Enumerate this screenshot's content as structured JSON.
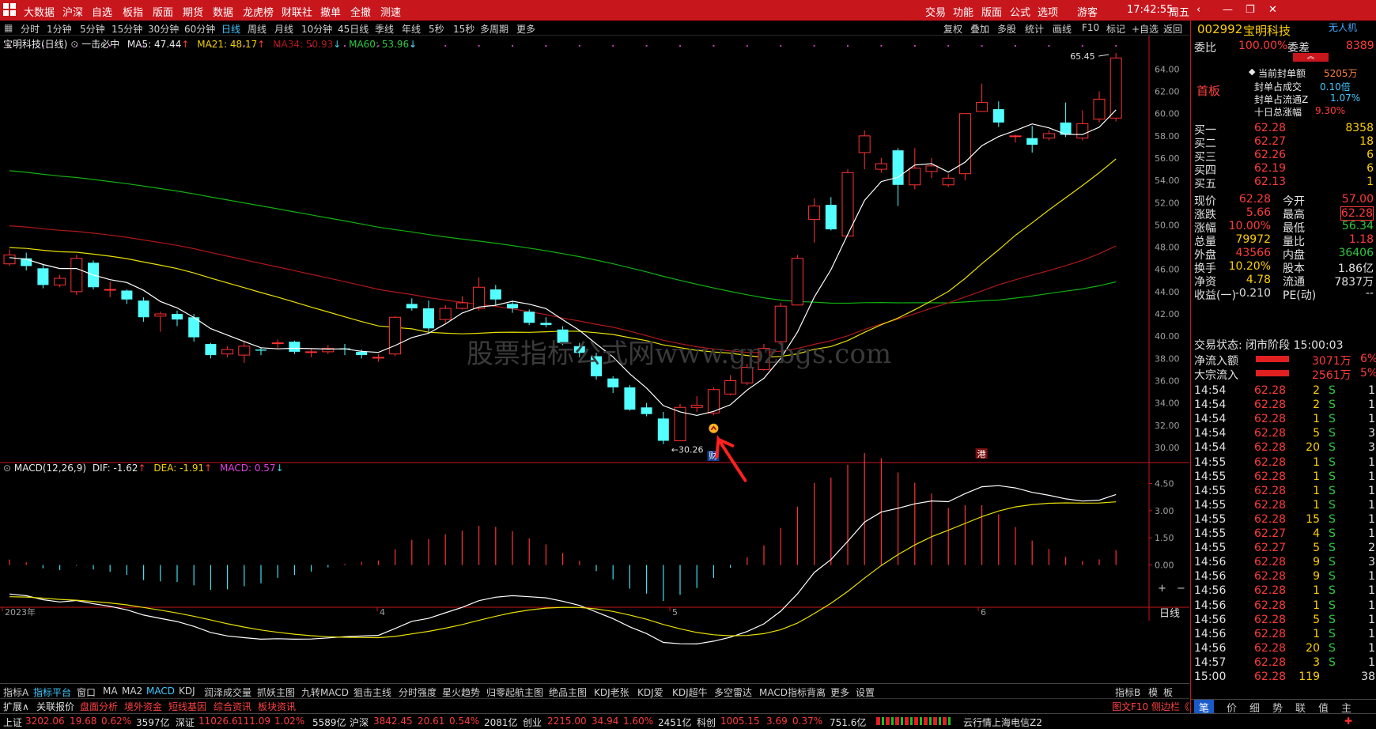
{
  "menubar": {
    "items": [
      "大数据",
      "沪深",
      "自选",
      "板指",
      "版面",
      "期货",
      "数据",
      "龙虎榜",
      "财联社",
      "撤单",
      "全撤",
      "测速"
    ],
    "right_items": [
      "交易",
      "功能",
      "版面",
      "公式",
      "选项",
      "游客"
    ],
    "clock": "17:42:55",
    "weekday": "周五"
  },
  "periods": [
    "分时",
    "1分钟",
    "5分钟",
    "15分钟",
    "30分钟",
    "60分钟",
    "日线",
    "周线",
    "月线",
    "10分钟",
    "45日线",
    "季线",
    "年线",
    "5秒",
    "15秒",
    "多周期",
    "更多"
  ],
  "period_active": "日线",
  "toolbar_right": [
    "复权",
    "叠加",
    "多股",
    "统计",
    "画线",
    "F10",
    "标记",
    "+自选",
    "返回"
  ],
  "chart_header": {
    "stock_title": "宝明科技(日线)",
    "formula": "一击必中",
    "ma5": "MA5: 47.44",
    "ma21": "MA21: 48.17",
    "ma34": "MA34: 50.93",
    "ma60": "MA60: 53.96"
  },
  "price_axis": [
    "64.00",
    "62.00",
    "60.00",
    "58.00",
    "56.00",
    "54.00",
    "52.00",
    "50.00",
    "48.00",
    "46.00",
    "44.00",
    "42.00",
    "40.00",
    "38.00",
    "36.00",
    "34.00",
    "32.00",
    "30.00"
  ],
  "annotations": {
    "high": "65.45",
    "low": "30.26",
    "cai": "财",
    "gang": "港"
  },
  "watermark": "股票指标公式网www.gpzbgs.com",
  "macd_header": {
    "name": "MACD(12,26,9)",
    "dif": "DIF: -1.62",
    "dea": "DEA: -1.91",
    "macd": "MACD: 0.57"
  },
  "macd_axis": [
    "4.50",
    "3.00",
    "1.50",
    "0.00"
  ],
  "date_axis": [
    "2023年",
    "4",
    "5",
    "6"
  ],
  "date_period_label": "日线",
  "indicator_tabs": [
    "指标A",
    "指标平台",
    "窗口",
    "MA",
    "MA2",
    "MACD",
    "KDJ",
    "润泽成交量",
    "抓妖主图",
    "九转MACD",
    "狙击主线",
    "分时强度",
    "星火趋势",
    "归零起航主图",
    "绝品主图",
    "KDJ老张",
    "KDJ爱",
    "KDJ超牛",
    "多空雷达",
    "MACD指标背离",
    "更多",
    "设置"
  ],
  "indicator_right": [
    "指标B",
    "模",
    "板"
  ],
  "sub_tabs": [
    "扩展∧",
    "关联报价",
    "盘面分析",
    "境外资金",
    "短线基因",
    "综合资讯",
    "板块资讯"
  ],
  "sub_right": "图文F10 侧边栏《",
  "chart_data": {
    "type": "candlestick",
    "candles": [
      [
        46.5,
        47.3,
        47.8,
        46.3
      ],
      [
        47.0,
        46.3,
        47.5,
        45.9
      ],
      [
        46.1,
        44.6,
        46.5,
        44.3
      ],
      [
        44.6,
        45.2,
        45.5,
        44.4
      ],
      [
        44.0,
        47.0,
        47.3,
        43.7
      ],
      [
        46.6,
        44.4,
        46.8,
        44.2
      ],
      [
        44.2,
        44.2,
        44.9,
        43.5
      ],
      [
        44.1,
        43.3,
        44.2,
        42.9
      ],
      [
        43.2,
        41.7,
        43.5,
        41.3
      ],
      [
        41.8,
        42.0,
        42.2,
        40.4
      ],
      [
        42.0,
        41.5,
        42.3,
        40.9
      ],
      [
        41.7,
        39.9,
        42.0,
        39.5
      ],
      [
        39.3,
        38.3,
        39.4,
        38.0
      ],
      [
        38.4,
        38.8,
        39.1,
        38.1
      ],
      [
        38.3,
        39.1,
        39.6,
        37.6
      ],
      [
        38.8,
        38.7,
        39.0,
        38.3
      ],
      [
        39.4,
        39.4,
        39.7,
        38.9
      ],
      [
        39.5,
        38.6,
        39.6,
        38.4
      ],
      [
        38.6,
        38.6,
        38.9,
        38.1
      ],
      [
        38.6,
        38.9,
        39.2,
        38.4
      ],
      [
        38.9,
        38.8,
        39.3,
        38.3
      ],
      [
        38.6,
        38.3,
        38.8,
        38.0
      ],
      [
        38.1,
        38.1,
        38.4,
        37.7
      ],
      [
        38.4,
        41.7,
        41.8,
        38.2
      ],
      [
        42.9,
        42.5,
        43.4,
        42.3
      ],
      [
        42.5,
        40.7,
        43.2,
        40.4
      ],
      [
        41.5,
        42.5,
        42.8,
        41.2
      ],
      [
        42.5,
        43.0,
        43.6,
        42.4
      ],
      [
        42.5,
        44.4,
        45.3,
        42.3
      ],
      [
        44.2,
        43.3,
        44.6,
        42.8
      ],
      [
        42.9,
        42.5,
        43.2,
        42.1
      ],
      [
        42.2,
        41.2,
        42.4,
        41.0
      ],
      [
        41.2,
        41.0,
        41.7,
        40.8
      ],
      [
        40.6,
        39.4,
        40.9,
        39.2
      ],
      [
        39.1,
        38.5,
        39.4,
        38.1
      ],
      [
        38.2,
        36.4,
        38.5,
        36.1
      ],
      [
        36.2,
        35.4,
        36.4,
        34.9
      ],
      [
        35.4,
        33.4,
        35.6,
        33.3
      ],
      [
        33.6,
        33.0,
        34.0,
        32.8
      ],
      [
        32.6,
        30.6,
        33.2,
        30.3
      ],
      [
        30.6,
        33.6,
        33.9,
        30.6
      ],
      [
        33.6,
        33.8,
        34.6,
        33.2
      ],
      [
        33.1,
        35.2,
        35.4,
        32.9
      ],
      [
        34.8,
        36.0,
        36.5,
        34.7
      ],
      [
        35.8,
        37.2,
        37.5,
        35.6
      ],
      [
        37.0,
        38.9,
        39.3,
        36.9
      ],
      [
        39.5,
        42.7,
        43.0,
        39.2
      ],
      [
        42.8,
        47.0,
        47.3,
        42.8
      ],
      [
        50.5,
        51.7,
        52.4,
        48.4
      ],
      [
        51.8,
        49.6,
        52.5,
        49.5
      ],
      [
        49.0,
        54.7,
        55.0,
        49.0
      ],
      [
        56.5,
        58.0,
        58.5,
        55.0
      ],
      [
        55.0,
        55.5,
        56.0,
        54.7
      ],
      [
        56.7,
        53.6,
        56.9,
        51.7
      ],
      [
        53.6,
        55.1,
        56.9,
        53.2
      ],
      [
        54.8,
        55.3,
        56.0,
        54.2
      ],
      [
        53.6,
        54.2,
        54.6,
        53.4
      ],
      [
        54.6,
        60.0,
        60.0,
        54.0
      ],
      [
        60.2,
        61.0,
        62.7,
        60.2
      ],
      [
        60.4,
        59.2,
        61.1,
        58.8
      ],
      [
        58.0,
        58.0,
        58.1,
        57.4
      ],
      [
        57.8,
        57.2,
        58.9,
        56.5
      ],
      [
        57.8,
        58.2,
        58.5,
        57.6
      ],
      [
        59.2,
        58.1,
        61.0,
        57.9
      ],
      [
        57.8,
        59.1,
        60.3,
        57.6
      ],
      [
        59.5,
        61.3,
        62.0,
        59.2
      ],
      [
        59.6,
        65.0,
        65.45,
        59.3
      ]
    ],
    "price_range": [
      29.0,
      65.45
    ],
    "macd_range": [
      -2.2,
      5.0
    ],
    "ma_colors": {
      "ma5": "#ffffff",
      "ma21": "#e8e000",
      "ma34": "#b01818",
      "ma60": "#10b010"
    },
    "up_color": "#ff3232",
    "down_color": "#54ffff"
  },
  "quote": {
    "code": "002992",
    "name": "宝明科技",
    "tag": "无人机",
    "weibi_label": "委比",
    "weibi": "100.00%",
    "weicha_label": "委差",
    "weicha": "8389",
    "status_badge": "首板",
    "seal_rows": [
      {
        "label": "当前封单额",
        "value": "5205万"
      },
      {
        "label": "封单占成交",
        "value": "0.10倍"
      },
      {
        "label": "封单占流通Z",
        "value": "1.07%"
      },
      {
        "label": "十日总涨幅",
        "value": "9.30%"
      }
    ],
    "buy_rows": [
      {
        "label": "买一",
        "price": "62.28",
        "vol": "8358"
      },
      {
        "label": "买二",
        "price": "62.27",
        "vol": "18"
      },
      {
        "label": "买三",
        "price": "62.26",
        "vol": "6"
      },
      {
        "label": "买四",
        "price": "62.19",
        "vol": "6"
      },
      {
        "label": "买五",
        "price": "62.13",
        "vol": "1"
      }
    ],
    "stats": [
      {
        "l1": "现价",
        "v1": "62.28",
        "l2": "今开",
        "v2": "57.00"
      },
      {
        "l1": "涨跌",
        "v1": "5.66",
        "l2": "最高",
        "v2": "62.28"
      },
      {
        "l1": "涨幅",
        "v1": "10.00%",
        "l2": "最低",
        "v2": "56.34"
      },
      {
        "l1": "总量",
        "v1": "79972",
        "l2": "量比",
        "v2": "1.18"
      },
      {
        "l1": "外盘",
        "v1": "43566",
        "l2": "内盘",
        "v2": "36406"
      },
      {
        "l1": "换手",
        "v1": "10.20%",
        "l2": "股本",
        "v2": "1.86亿"
      },
      {
        "l1": "净资",
        "v1": "4.78",
        "l2": "流通",
        "v2": "7837万"
      },
      {
        "l1": "收益(一)",
        "v1": "-0.210",
        "l2": "PE(动)",
        "v2": "--"
      }
    ],
    "trade_state": "交易状态: 闭市阶段 15:00:03",
    "flows": [
      {
        "label": "净流入额",
        "value": "3071万",
        "pct": "6%"
      },
      {
        "label": "大宗流入",
        "value": "2561万",
        "pct": "5%"
      }
    ],
    "ticks": [
      [
        "14:54",
        "62.28",
        "2",
        "S",
        "1"
      ],
      [
        "14:54",
        "62.28",
        "2",
        "S",
        "1"
      ],
      [
        "14:54",
        "62.28",
        "1",
        "S",
        "1"
      ],
      [
        "14:54",
        "62.28",
        "5",
        "S",
        "3"
      ],
      [
        "14:54",
        "62.28",
        "20",
        "S",
        "3"
      ],
      [
        "14:55",
        "62.28",
        "1",
        "S",
        "1"
      ],
      [
        "14:55",
        "62.28",
        "1",
        "S",
        "1"
      ],
      [
        "14:55",
        "62.28",
        "1",
        "S",
        "1"
      ],
      [
        "14:55",
        "62.28",
        "1",
        "S",
        "1"
      ],
      [
        "14:55",
        "62.28",
        "15",
        "S",
        "1"
      ],
      [
        "14:55",
        "62.27",
        "4",
        "S",
        "1"
      ],
      [
        "14:55",
        "62.27",
        "5",
        "S",
        "2"
      ],
      [
        "14:56",
        "62.28",
        "9",
        "S",
        "3"
      ],
      [
        "14:56",
        "62.28",
        "9",
        "S",
        "1"
      ],
      [
        "14:56",
        "62.28",
        "1",
        "S",
        "1"
      ],
      [
        "14:56",
        "62.28",
        "1",
        "S",
        "1"
      ],
      [
        "14:56",
        "62.28",
        "5",
        "S",
        "1"
      ],
      [
        "14:56",
        "62.28",
        "1",
        "S",
        "1"
      ],
      [
        "14:56",
        "62.28",
        "20",
        "S",
        "1"
      ],
      [
        "14:57",
        "62.28",
        "3",
        "S",
        "1"
      ],
      [
        "15:00",
        "62.28",
        "119",
        "",
        "38"
      ]
    ],
    "bottom_tabs": [
      "笔",
      "价",
      "细",
      "势",
      "联",
      "值",
      "主"
    ]
  },
  "status": {
    "items": [
      {
        "name": "上证",
        "value": "3202.06",
        "chg": "19.68",
        "pct": "0.62%",
        "amt": "3597亿"
      },
      {
        "name": "深证",
        "value": "11026.6",
        "chg": "111.09",
        "pct": "1.02%",
        "amt": "5589亿"
      },
      {
        "name": "沪深",
        "value": "3842.45",
        "chg": "20.61",
        "pct": "0.54%",
        "amt": "2081亿"
      },
      {
        "name": "创业",
        "value": "2215.00",
        "chg": "34.94",
        "pct": "1.60%",
        "amt": "2451亿"
      },
      {
        "name": "科创",
        "value": "1005.15",
        "chg": "3.69",
        "pct": "0.37%",
        "amt": "751.6亿"
      }
    ],
    "server": "云行情上海电信Z2"
  }
}
